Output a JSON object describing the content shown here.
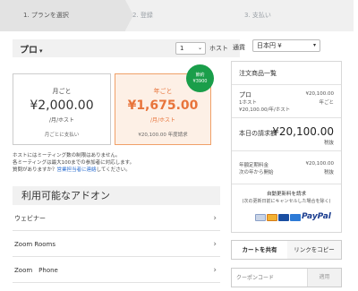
{
  "steps": [
    "1. プランを選択",
    "2. 登録",
    "3. 支払い"
  ],
  "plan": {
    "title": "プロ",
    "qty_value": "1",
    "qty_unit": "ホスト"
  },
  "monthly": {
    "label": "月ごと",
    "price": "¥2,000.00",
    "unit": "/月/ホスト",
    "note": "月ごとに支払い"
  },
  "annual": {
    "label": "年ごと",
    "price": "¥1,675.00",
    "unit": "/月/ホスト",
    "note": "¥20,100.00 年度請求",
    "badge_line1": "節約",
    "badge_line2": "¥3900"
  },
  "notes": {
    "line1": "ホストにはミーティング数の制限はありません。",
    "line2": "各ミーティングは最大100までの参加者に対応します。",
    "line3_prefix": "質問がありますか？",
    "line3_link": "営業担当者に連絡",
    "line3_suffix": "してください。"
  },
  "addons": {
    "header": "利用可能なアドオン",
    "items": [
      "ウェビナー",
      "Zoom Rooms",
      "Zoom　Phone"
    ]
  },
  "currency": {
    "label": "通貨",
    "value": "日本円 ¥"
  },
  "summary": {
    "title": "注文商品一覧",
    "item_name": "プロ",
    "item_price": "¥20,100.00",
    "item_hosts": "1ホスト",
    "item_period": "年ごと",
    "item_detail": "¥20,100.00/年/ホスト",
    "due_label": "本日の請求額",
    "due_amount": "¥20,100.00",
    "due_tax": "税抜",
    "annual_label": "年額定期料金",
    "annual_sub": "次の年から開始",
    "annual_amount": "¥20,100.00",
    "annual_tax": "税抜",
    "autorenew": "自動更新料を請求",
    "autorenew_sub": "(次の更新日前にキャンセルした場合を除く)",
    "paypal": "PayPal"
  },
  "share": {
    "cart": "カートを共有",
    "link": "リンクをコピー"
  },
  "coupon": {
    "placeholder": "クーポンコード",
    "apply": "適用"
  }
}
